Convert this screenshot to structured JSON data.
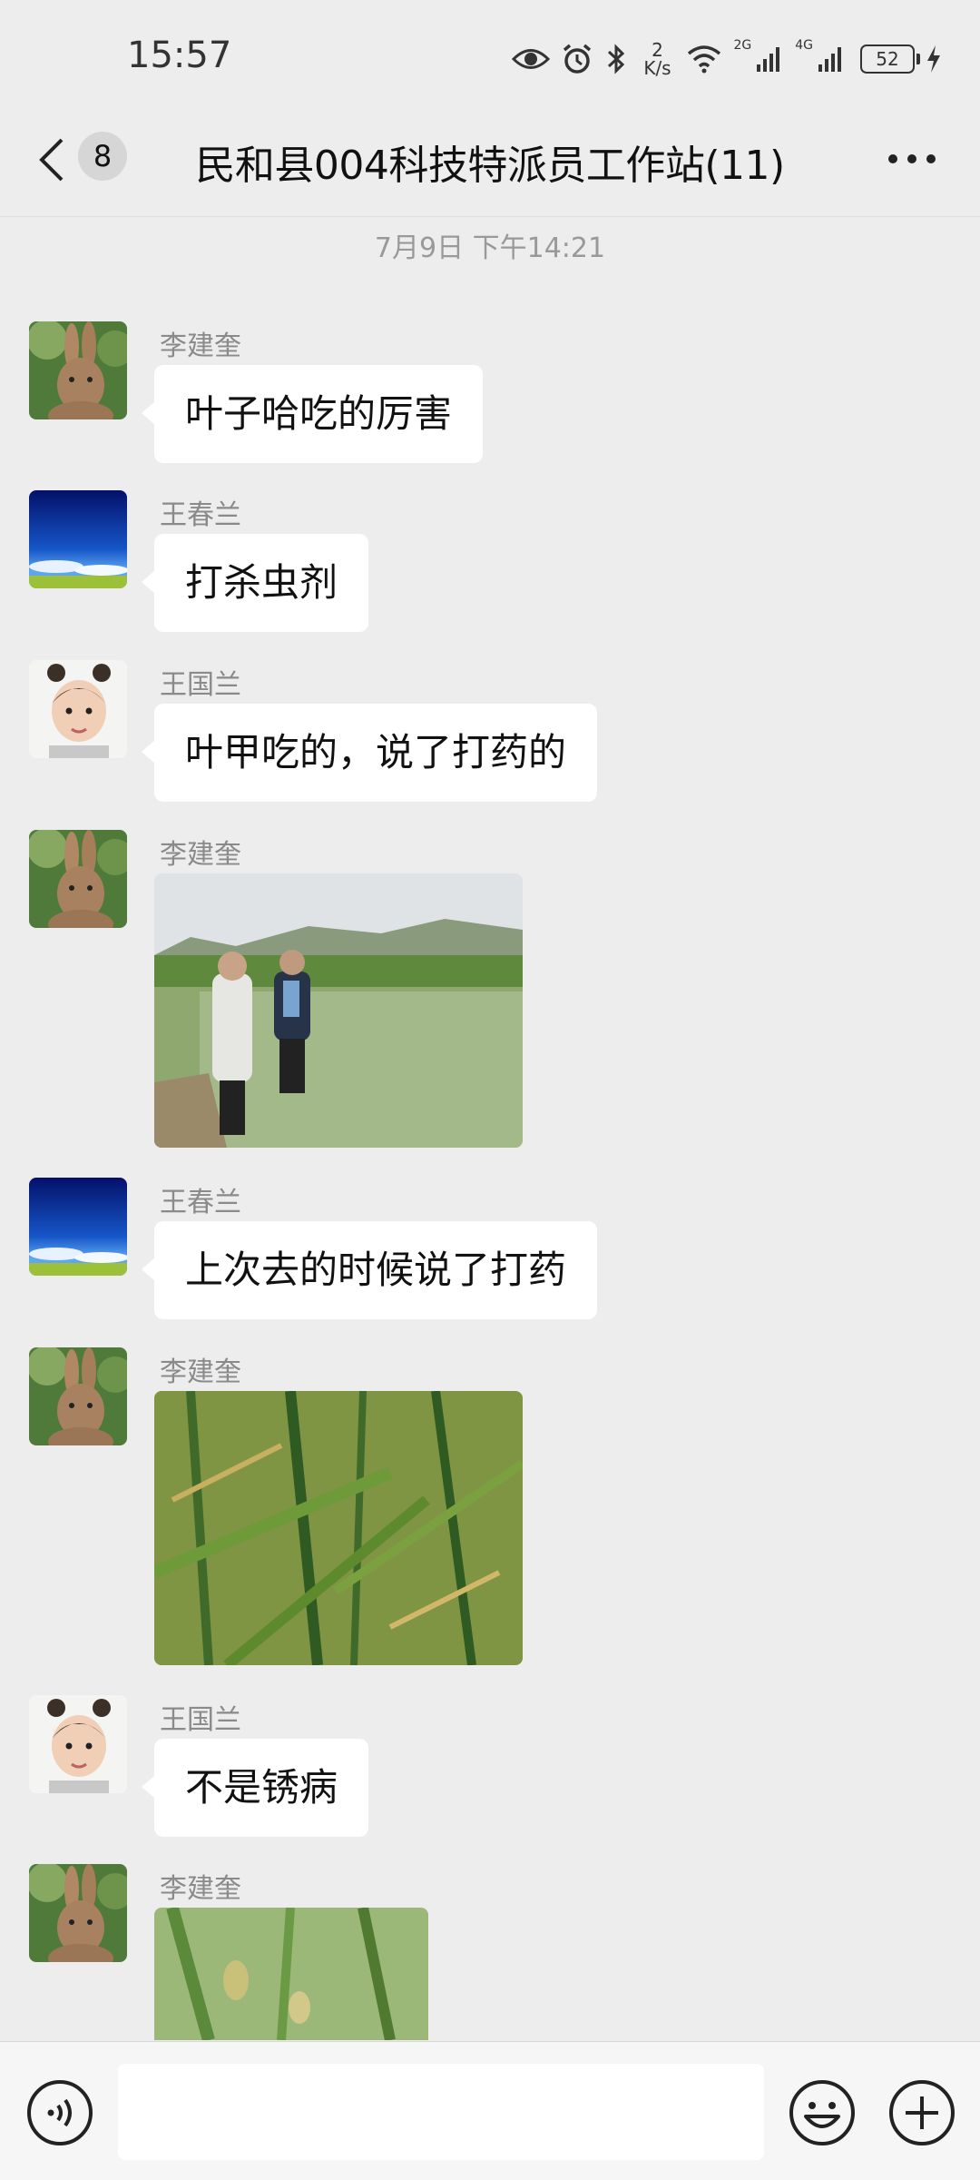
{
  "status_bar": {
    "time": "15:57",
    "net_speed_value": "2",
    "net_speed_unit": "K/s",
    "sig1": "2G",
    "sig2": "4G",
    "battery": "52"
  },
  "header": {
    "unread_count": "8",
    "title": "民和县004科技特派员工作站(11)"
  },
  "chat": {
    "timestamp": "7月9日 下午14:21",
    "messages": [
      {
        "sender": "李建奎",
        "avatar": "rabbit",
        "text": "叶子哈吃的厉害"
      },
      {
        "sender": "王春兰",
        "avatar": "sky",
        "text": "打杀虫剂"
      },
      {
        "sender": "王国兰",
        "avatar": "child",
        "text": "叶甲吃的，说了打药的"
      },
      {
        "sender": "李建奎",
        "avatar": "rabbit",
        "image": "field-with-two-men"
      },
      {
        "sender": "王春兰",
        "avatar": "sky",
        "text": "上次去的时候说了打药"
      },
      {
        "sender": "李建奎",
        "avatar": "rabbit",
        "image": "wheat-leaves-closeup"
      },
      {
        "sender": "王国兰",
        "avatar": "child",
        "text": "不是锈病"
      },
      {
        "sender": "李建奎",
        "avatar": "rabbit",
        "image": "wheat-ear-closeup"
      }
    ]
  },
  "input_bar": {
    "placeholder": ""
  },
  "colors": {
    "background": "#ededed",
    "bubble": "#ffffff",
    "secondary_text": "#8a8a8a"
  }
}
